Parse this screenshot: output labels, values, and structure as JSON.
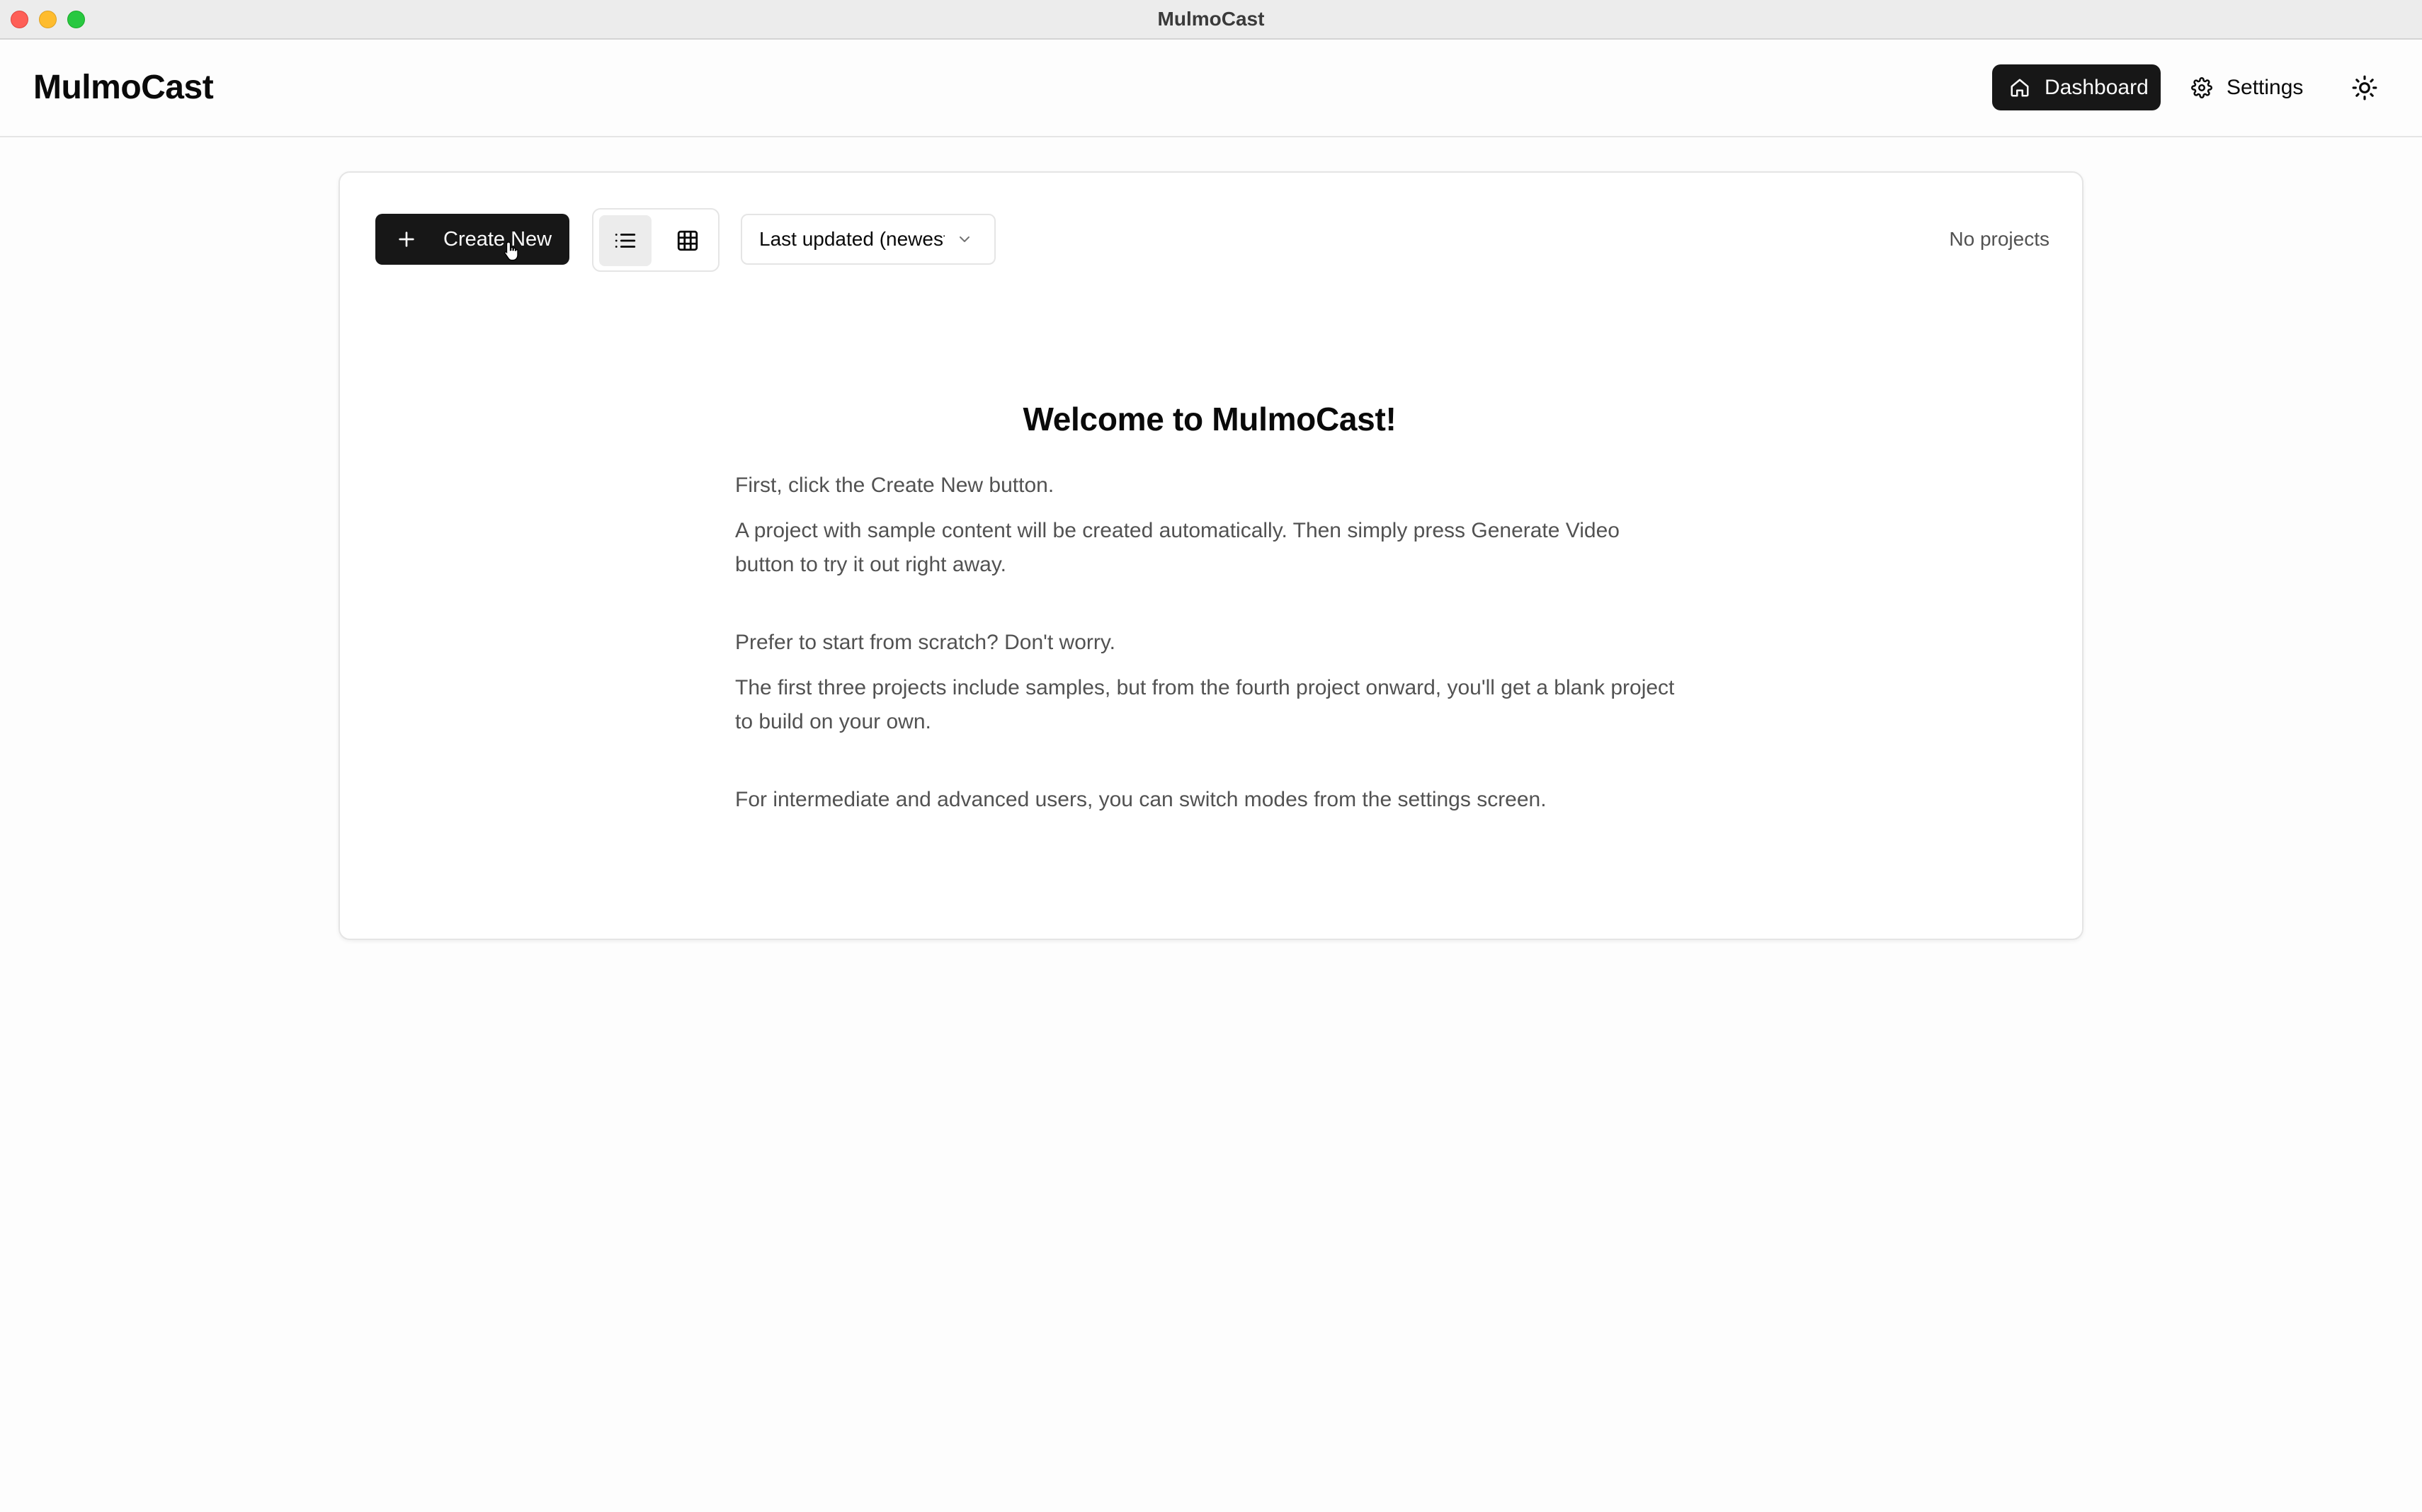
{
  "window": {
    "title": "MulmoCast"
  },
  "header": {
    "logo": "MulmoCast",
    "nav": {
      "dashboard_label": "Dashboard",
      "settings_label": "Settings"
    },
    "icons": {
      "dashboard": "home-icon",
      "settings": "gear-icon",
      "theme": "sun-icon"
    }
  },
  "toolbar": {
    "create_label": "Create New",
    "view_modes": [
      "list",
      "grid"
    ],
    "active_view": "list",
    "sort_value": "Last updated (newest first)",
    "project_count": "No projects"
  },
  "welcome": {
    "title": "Welcome to MulmoCast!",
    "p1": "First, click the Create New button.",
    "p2": "A project with sample content will be created automatically. Then simply press Generate Video button to try it out right away.",
    "p3": "Prefer to start from scratch? Don't worry.",
    "p4": "The first three projects include samples, but from the fourth project onward, you'll get a blank project to build on your own.",
    "p5": "For intermediate and advanced users, you can switch modes from the settings screen."
  },
  "colors": {
    "primary": "#171717",
    "primary_text": "#fafafa",
    "muted_text": "#525252",
    "border": "#e5e5e5",
    "traffic_close": "#fe5f57",
    "traffic_min": "#febc2e",
    "traffic_max": "#28c840"
  }
}
